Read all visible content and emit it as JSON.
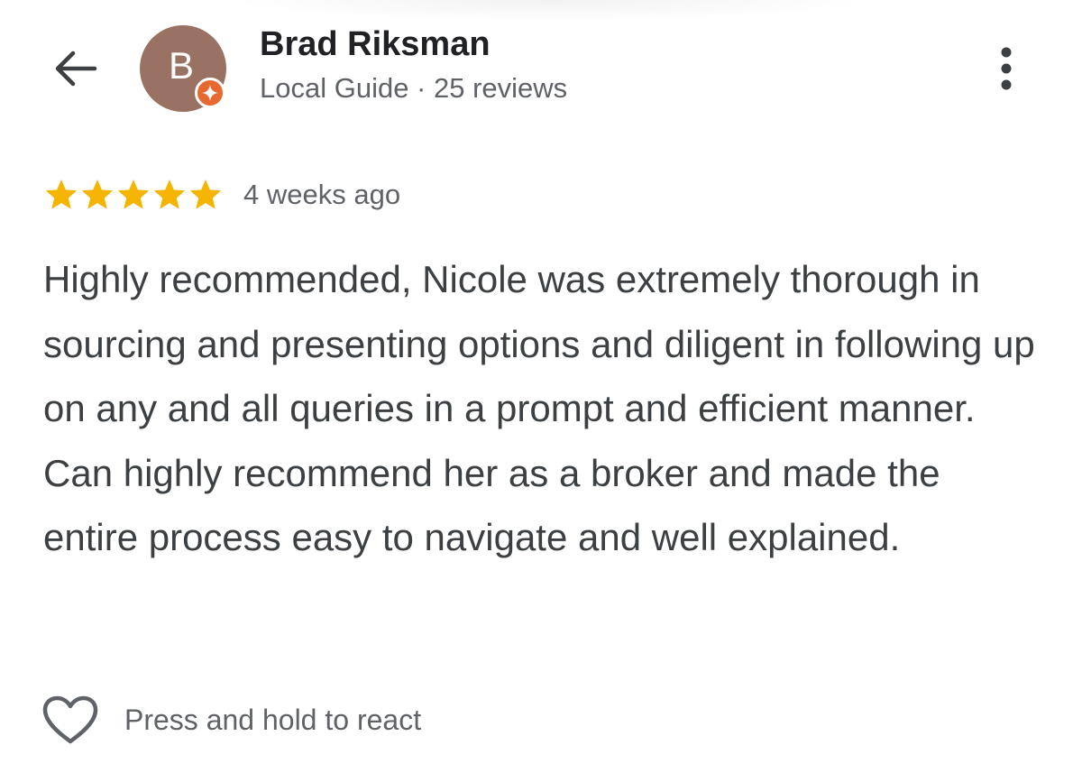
{
  "header": {
    "avatar_letter": "B",
    "reviewer_name": "Brad Riksman",
    "reviewer_meta": "Local Guide · 25 reviews"
  },
  "review": {
    "rating": 5,
    "rating_max": 5,
    "date": "4 weeks ago",
    "text": "Highly recommended, Nicole was extremely thorough in sourcing and presenting options and diligent in following up on any and all queries in a prompt and efficient manner. Can highly recommend her as a broker and made the entire process easy to navigate and well explained."
  },
  "reaction": {
    "label": "Press and hold to react"
  },
  "icons": {
    "back": "arrow-left-icon",
    "more": "more-vertical-icon",
    "badge": "local-guide-star-icon",
    "star": "star-icon",
    "heart": "heart-outline-icon"
  },
  "colors": {
    "avatar_bg": "#9a7264",
    "badge_bg": "#e8692f",
    "star": "#f4b400",
    "primary_text": "#202124",
    "secondary_text": "#5f6368",
    "body_text": "#3c4043"
  }
}
